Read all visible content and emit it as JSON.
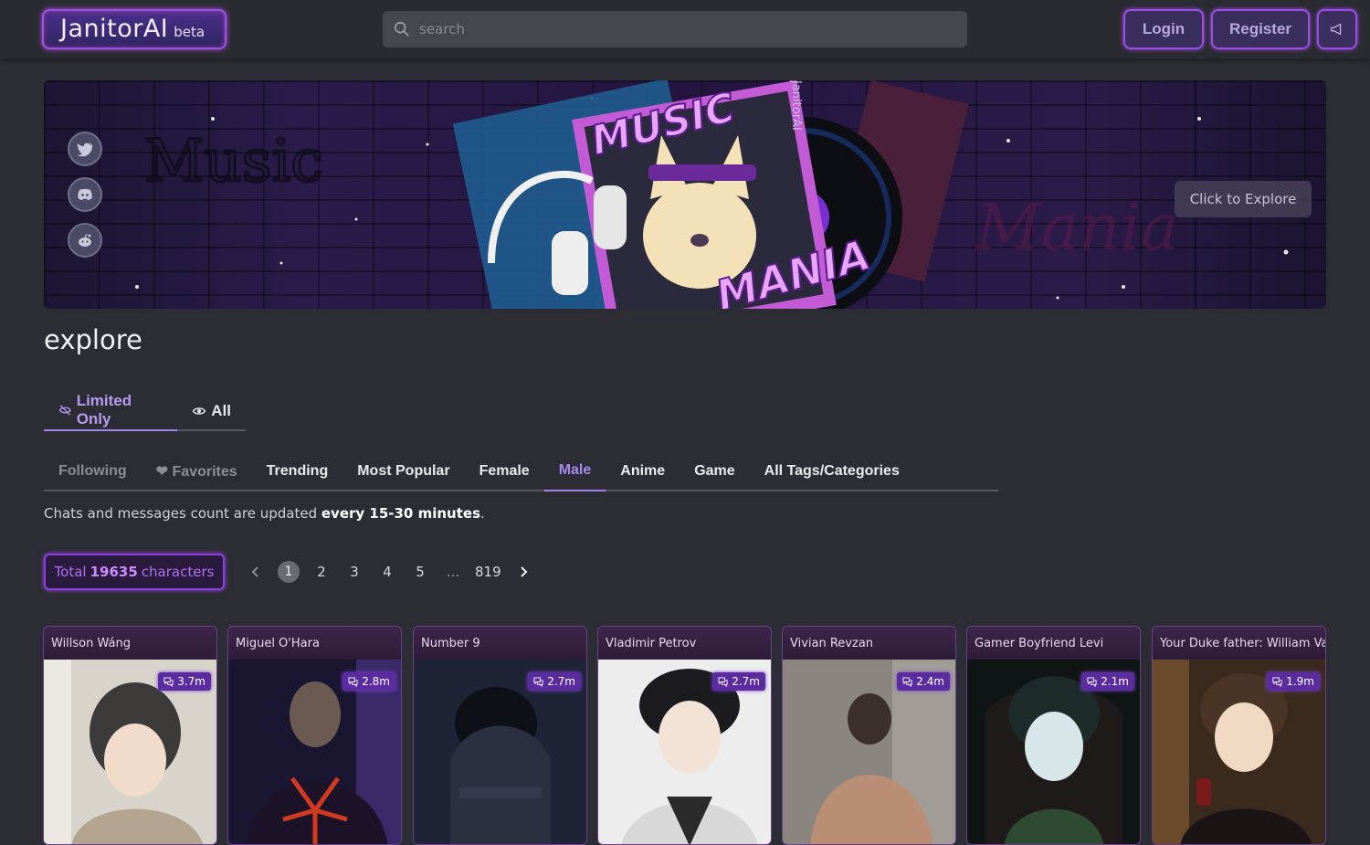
{
  "header": {
    "logo": "JanitorAI",
    "logo_tag": "beta",
    "search_placeholder": "search",
    "login_label": "Login",
    "register_label": "Register"
  },
  "banner": {
    "title_line1": "MUSIC",
    "title_line2": "MANIA",
    "brand": "JanitorAI",
    "explore_label": "Click to Explore",
    "social_icons": [
      "twitter-icon",
      "discord-icon",
      "reddit-icon"
    ]
  },
  "page": {
    "title": "explore",
    "mode_tabs": [
      "Limited Only",
      "All"
    ],
    "category_tabs": [
      {
        "label": " Following",
        "state": "dim"
      },
      {
        "label": "❤ Favorites",
        "state": "dim"
      },
      {
        "label": " Trending",
        "state": "normal"
      },
      {
        "label": " Most Popular",
        "state": "normal"
      },
      {
        "label": "  Female",
        "state": "normal"
      },
      {
        "label": "  Male",
        "state": "active"
      },
      {
        "label": " Anime",
        "state": "normal"
      },
      {
        "label": " Game",
        "state": "normal"
      },
      {
        "label": " All Tags/Categories",
        "state": "normal"
      }
    ],
    "note_prefix": "Chats and messages count are updated ",
    "note_bold": "every 15-30 minutes",
    "note_suffix": "."
  },
  "pagination": {
    "total_prefix": "Total",
    "total_count": "19635",
    "total_suffix": "characters",
    "pages": [
      "1",
      "2",
      "3",
      "4",
      "5"
    ],
    "ellipsis": "...",
    "last_page": "819",
    "current": "1"
  },
  "characters": [
    {
      "name": "Willson Wáng",
      "count": "3.7m"
    },
    {
      "name": "Miguel O'Hara",
      "count": "2.8m"
    },
    {
      "name": "Number 9",
      "count": "2.7m"
    },
    {
      "name": "Vladimir Petrov",
      "count": "2.7m"
    },
    {
      "name": "Vivian Revzan",
      "count": "2.4m"
    },
    {
      "name": "Gamer Boyfriend Levi",
      "count": "2.1m"
    },
    {
      "name": "Your Duke father: William Var",
      "count": "1.9m"
    }
  ],
  "colors": {
    "accent": "#a584e8",
    "glow": "#9a4ee8",
    "background": "#2c2d34",
    "badge": "#5a2ca0"
  }
}
